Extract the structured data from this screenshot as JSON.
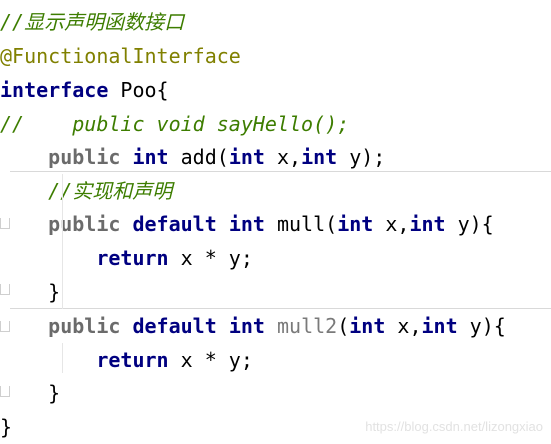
{
  "editor": {
    "lines": [
      [
        {
          "t": "//显示声明函数接口",
          "c": "comment"
        }
      ],
      [
        {
          "t": "@FunctionalInterface",
          "c": "annotation"
        }
      ],
      [
        {
          "t": "interface",
          "c": "keyword"
        },
        {
          "t": " Poo{",
          "c": "plain"
        }
      ],
      [
        {
          "t": "//    public void sayHello();",
          "c": "comment"
        }
      ],
      [
        {
          "t": "    ",
          "c": "plain"
        },
        {
          "t": "public",
          "c": "muted-keyword"
        },
        {
          "t": " ",
          "c": "plain"
        },
        {
          "t": "int",
          "c": "keyword"
        },
        {
          "t": " add(",
          "c": "plain"
        },
        {
          "t": "int",
          "c": "keyword"
        },
        {
          "t": " x,",
          "c": "plain"
        },
        {
          "t": "int",
          "c": "keyword"
        },
        {
          "t": " y);",
          "c": "plain"
        }
      ],
      [
        {
          "t": "    //实现和声明",
          "c": "comment"
        }
      ],
      [
        {
          "t": "    ",
          "c": "plain"
        },
        {
          "t": "public",
          "c": "muted-keyword"
        },
        {
          "t": " ",
          "c": "plain"
        },
        {
          "t": "default",
          "c": "keyword"
        },
        {
          "t": " ",
          "c": "plain"
        },
        {
          "t": "int",
          "c": "keyword"
        },
        {
          "t": " mull(",
          "c": "plain"
        },
        {
          "t": "int",
          "c": "keyword"
        },
        {
          "t": " x,",
          "c": "plain"
        },
        {
          "t": "int",
          "c": "keyword"
        },
        {
          "t": " y){",
          "c": "plain"
        }
      ],
      [
        {
          "t": "        ",
          "c": "plain"
        },
        {
          "t": "return",
          "c": "keyword"
        },
        {
          "t": " x * y;",
          "c": "plain"
        }
      ],
      [
        {
          "t": "    }",
          "c": "plain"
        }
      ],
      [
        {
          "t": "    ",
          "c": "plain"
        },
        {
          "t": "public",
          "c": "muted-keyword"
        },
        {
          "t": " ",
          "c": "plain"
        },
        {
          "t": "default",
          "c": "keyword"
        },
        {
          "t": " ",
          "c": "plain"
        },
        {
          "t": "int",
          "c": "keyword"
        },
        {
          "t": " ",
          "c": "plain"
        },
        {
          "t": "mull2",
          "c": "method-grey"
        },
        {
          "t": "(",
          "c": "plain"
        },
        {
          "t": "int",
          "c": "keyword"
        },
        {
          "t": " x,",
          "c": "plain"
        },
        {
          "t": "int",
          "c": "keyword"
        },
        {
          "t": " y){",
          "c": "plain"
        }
      ],
      [
        {
          "t": "        ",
          "c": "plain"
        },
        {
          "t": "return",
          "c": "keyword"
        },
        {
          "t": " x * y;",
          "c": "plain"
        }
      ],
      [
        {
          "t": "    }",
          "c": "plain"
        }
      ],
      [
        {
          "t": "}",
          "c": "plain"
        }
      ]
    ]
  },
  "watermark": "https://blog.csdn.net/lizongxiao"
}
